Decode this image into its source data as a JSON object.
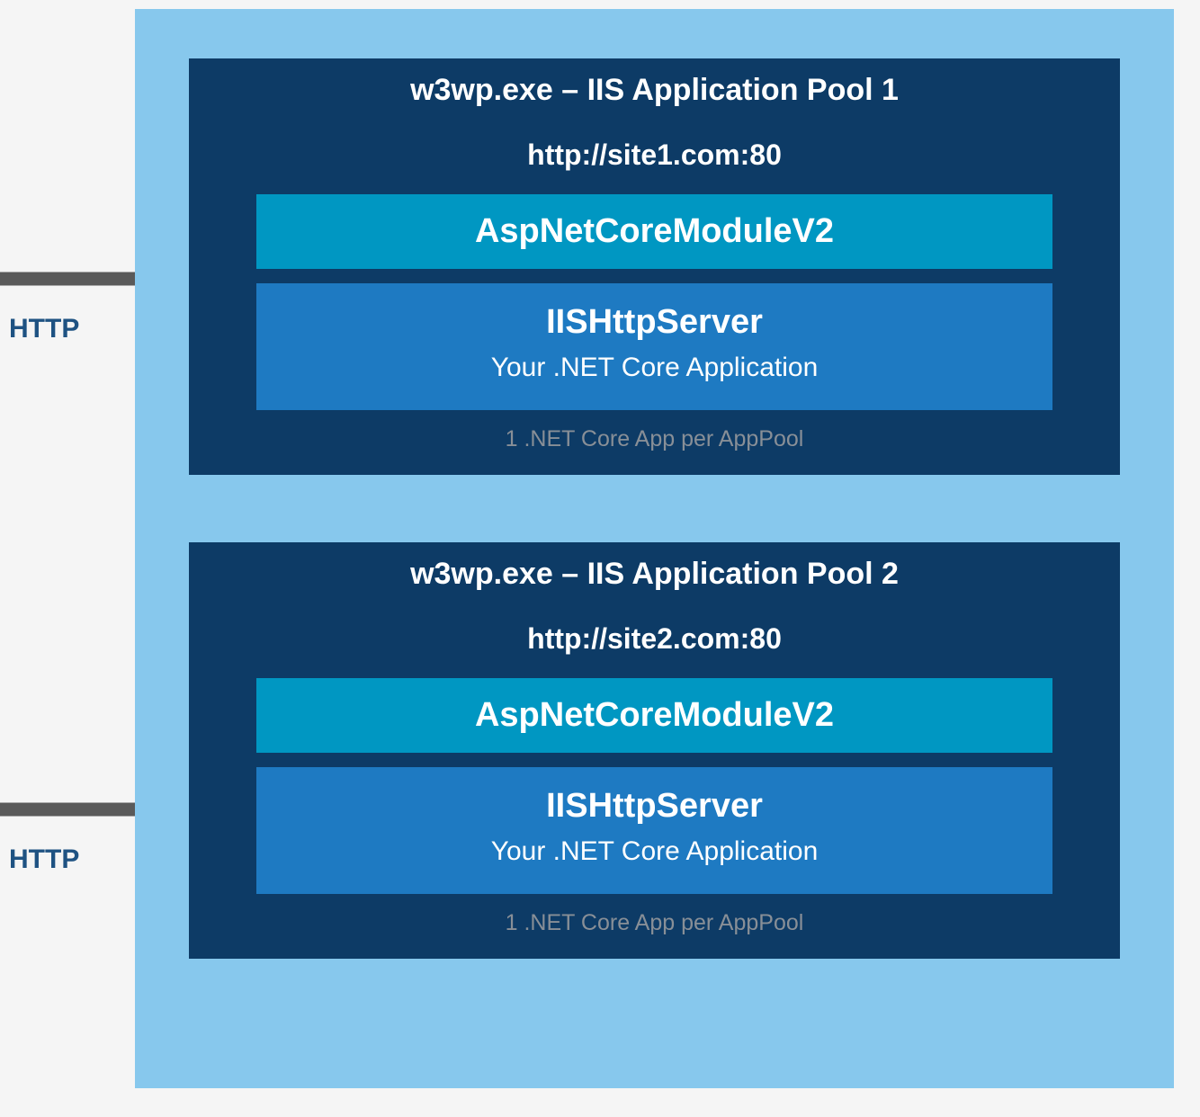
{
  "arrows": {
    "label1": "HTTP",
    "label2": "HTTP"
  },
  "pool1": {
    "header": "w3wp.exe – IIS Application Pool 1",
    "url": "http://site1.com:80",
    "module": "AspNetCoreModuleV2",
    "server_title": "IISHttpServer",
    "server_sub": "Your .NET Core Application",
    "footnote": "1 .NET Core App per AppPool"
  },
  "pool2": {
    "header": "w3wp.exe – IIS Application Pool 2",
    "url": "http://site2.com:80",
    "module": "AspNetCoreModuleV2",
    "server_title": "IISHttpServer",
    "server_sub": "Your .NET Core Application",
    "footnote": "1 .NET Core App per AppPool"
  }
}
